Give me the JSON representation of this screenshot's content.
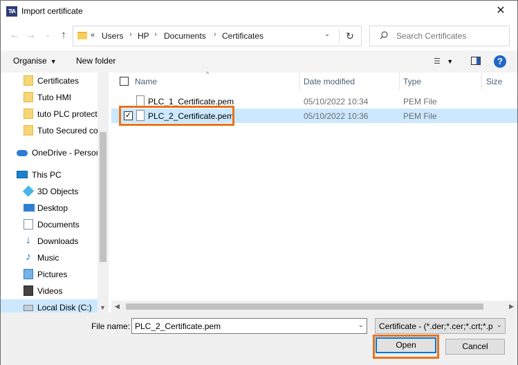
{
  "window": {
    "title": "Import certificate",
    "app_icon_text": "TIA",
    "close_glyph": "✕"
  },
  "navigation": {
    "address": {
      "chevrons": "«",
      "crumbs": [
        "Users",
        "HP",
        "Documents",
        "Certificates"
      ]
    },
    "search_placeholder": "Search Certificates"
  },
  "toolbar": {
    "organise_label": "Organise",
    "new_folder_label": "New folder",
    "help_label": "?"
  },
  "nav_pane": {
    "items": [
      {
        "label": "Certificates",
        "icon": "folder-icon"
      },
      {
        "label": "Tuto HMI",
        "icon": "folder-icon"
      },
      {
        "label": "tuto PLC protect",
        "icon": "folder-icon"
      },
      {
        "label": "Tuto Secured co",
        "icon": "folder-icon"
      },
      {
        "label": "OneDrive - Person",
        "icon": "onedrive-icon"
      },
      {
        "label": "This PC",
        "icon": "pc-icon"
      },
      {
        "label": "3D Objects",
        "icon": "3d-objects-icon"
      },
      {
        "label": "Desktop",
        "icon": "desktop-icon"
      },
      {
        "label": "Documents",
        "icon": "documents-icon"
      },
      {
        "label": "Downloads",
        "icon": "downloads-icon"
      },
      {
        "label": "Music",
        "icon": "music-icon"
      },
      {
        "label": "Pictures",
        "icon": "pictures-icon"
      },
      {
        "label": "Videos",
        "icon": "videos-icon"
      },
      {
        "label": "Local Disk (C:)",
        "icon": "disk-icon"
      }
    ]
  },
  "file_list": {
    "columns": [
      "Name",
      "Date modified",
      "Type",
      "Size"
    ],
    "rows": [
      {
        "name": "PLC_1_Certificate.pem",
        "date": "05/10/2022 10:34",
        "type": "PEM File",
        "selected": false
      },
      {
        "name": "PLC_2_Certificate.pem",
        "date": "05/10/2022 10:36",
        "type": "PEM File",
        "selected": true
      }
    ]
  },
  "footer": {
    "file_name_label": "File name:",
    "file_name_value": "PLC_2_Certificate.pem",
    "filter_value": "Certificate -  (*.der;*.cer;*.crt;*.p",
    "open_label": "Open",
    "cancel_label": "Cancel"
  },
  "colors": {
    "highlight": "#e8731c",
    "selection": "#cce8ff",
    "accent": "#0078d7"
  }
}
